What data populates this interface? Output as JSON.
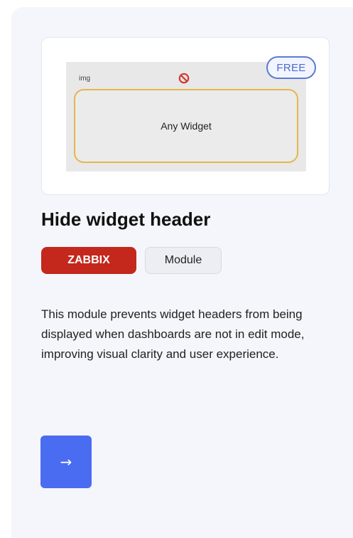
{
  "card": {
    "preview": {
      "free_badge": "FREE",
      "mock_img_label": "img",
      "mock_icon": "ban-icon",
      "mock_body_label": "Any Widget"
    },
    "title": "Hide widget header",
    "tags": [
      {
        "label": "ZABBIX",
        "color": "#c4271c"
      },
      {
        "label": "Module",
        "color": "#eceef3"
      }
    ],
    "description": "This module prevents widget headers from being displayed when dashboards are not in edit mode, improving visual clarity and user experience.",
    "action": {
      "icon": "arrow-right-icon",
      "glyph": "→",
      "color": "#4a6cf1"
    }
  }
}
